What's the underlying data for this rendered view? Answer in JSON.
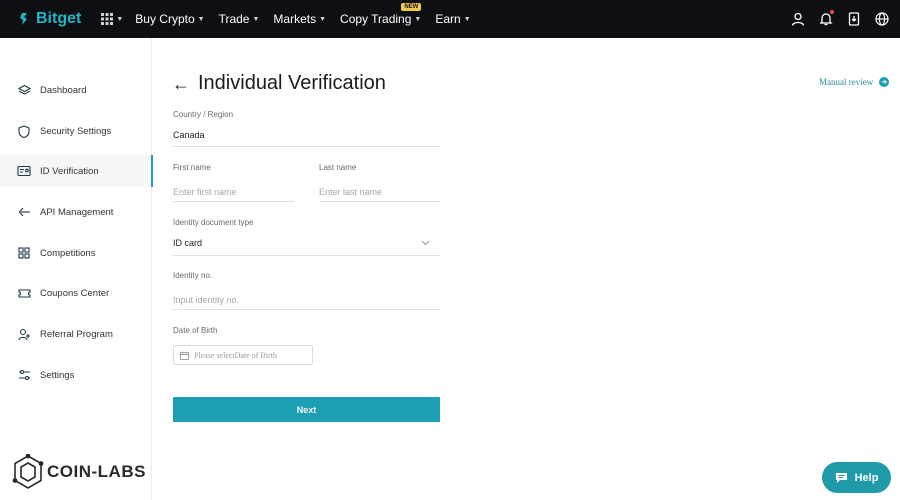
{
  "header": {
    "brand": "Bitget",
    "nav": [
      {
        "label": "Buy Crypto"
      },
      {
        "label": "Trade"
      },
      {
        "label": "Markets"
      },
      {
        "label": "Copy Trading",
        "badge": "NEW"
      },
      {
        "label": "Earn"
      }
    ],
    "icons": [
      "user-icon",
      "bell-icon",
      "download-icon",
      "globe-icon"
    ]
  },
  "sidebar": {
    "items": [
      {
        "label": "Dashboard",
        "icon": "layers-icon"
      },
      {
        "label": "Security Settings",
        "icon": "shield-icon"
      },
      {
        "label": "ID Verification",
        "icon": "id-card-icon",
        "active": true
      },
      {
        "label": "API Management",
        "icon": "api-icon"
      },
      {
        "label": "Competitions",
        "icon": "grid-icon"
      },
      {
        "label": "Coupons Center",
        "icon": "coupon-icon"
      },
      {
        "label": "Referral Program",
        "icon": "referral-icon"
      },
      {
        "label": "Settings",
        "icon": "sliders-icon"
      }
    ]
  },
  "watermark": "COIN-LABS",
  "main": {
    "title": "Individual Verification",
    "manual_review": "Manual review",
    "country": {
      "label": "Country / Region",
      "value": "Canada"
    },
    "first_name": {
      "label": "First name",
      "placeholder": "Enter first name"
    },
    "last_name": {
      "label": "Last name",
      "placeholder": "Enter last name"
    },
    "doc_type": {
      "label": "Identity document type",
      "value": "ID card"
    },
    "identity_no": {
      "label": "Identity no.",
      "placeholder": "Input identity no."
    },
    "dob": {
      "label": "Date of Birth",
      "placeholder": "Please selectDate of Birth"
    },
    "next": "Next"
  },
  "help": "Help",
  "colors": {
    "accent": "#1c9fb2",
    "topbar": "#0d0f12",
    "brand": "#1fb6c6"
  }
}
